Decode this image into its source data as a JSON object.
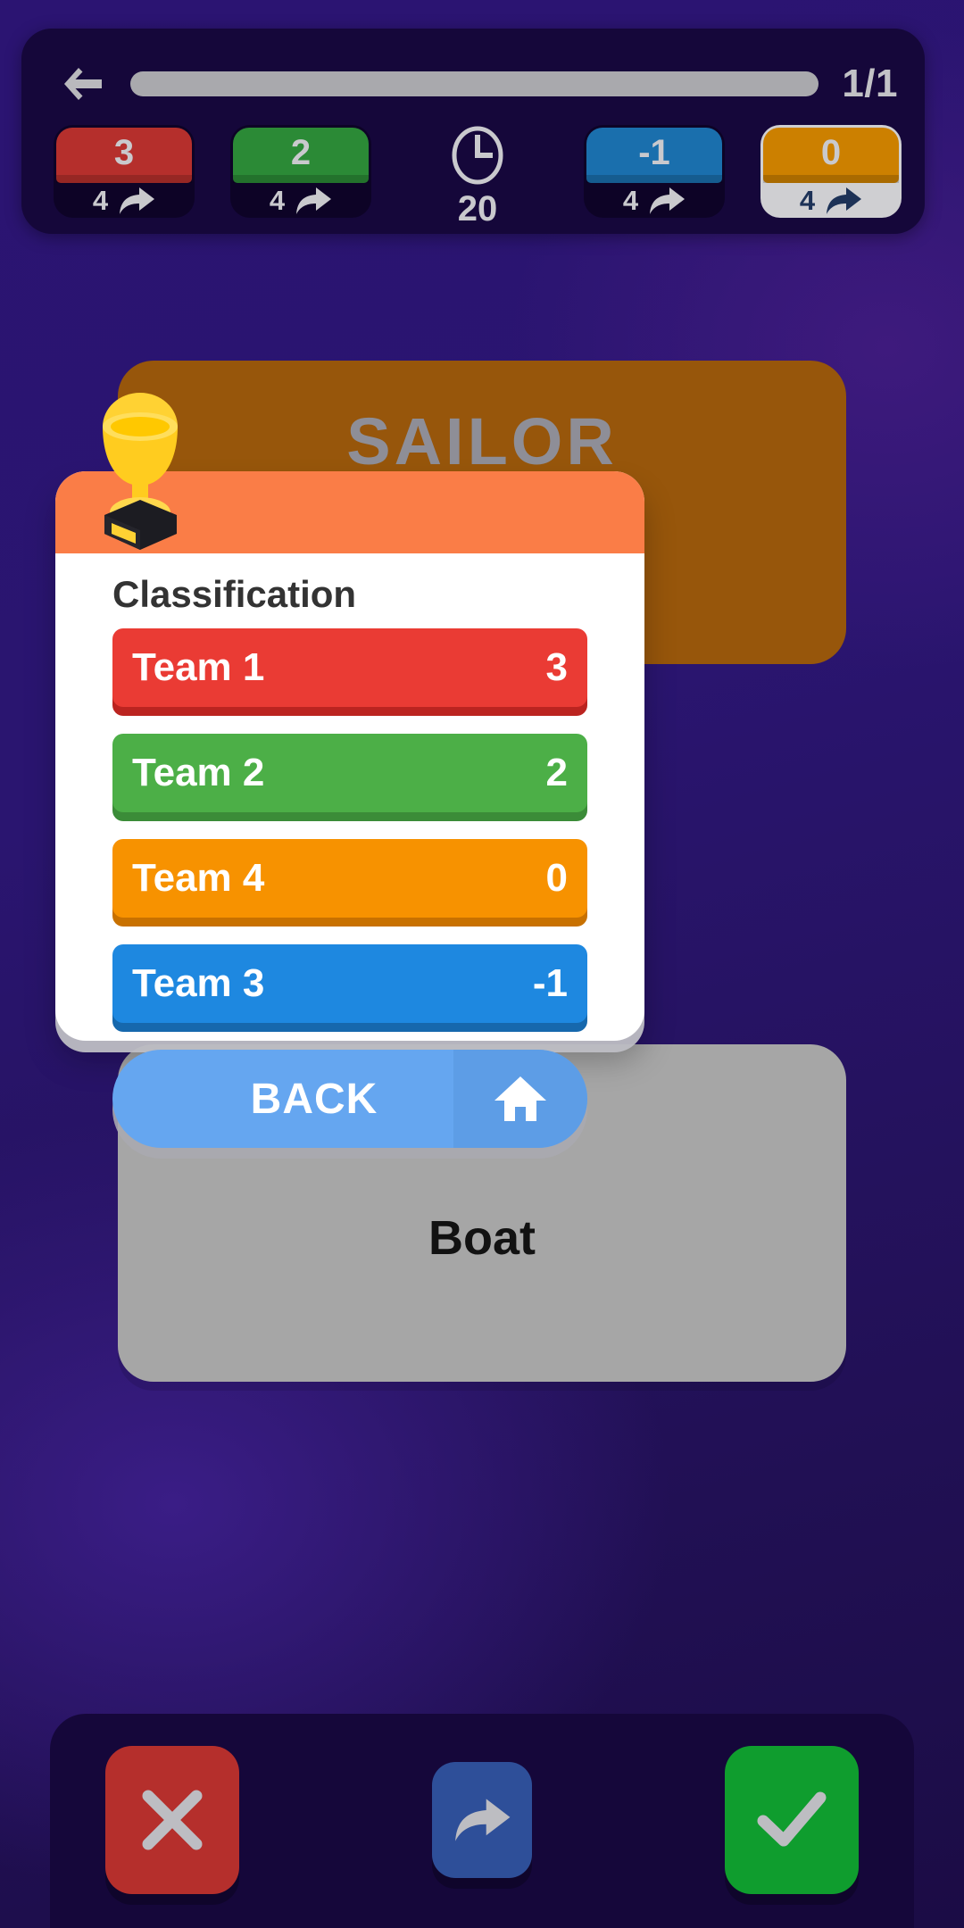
{
  "hud": {
    "back_icon": "back-arrow-icon",
    "progress_label": "",
    "page_count": "1/1",
    "clock": {
      "icon": "clock-icon",
      "seconds": "20"
    },
    "cards": [
      {
        "score": "3",
        "count": "4",
        "color": "#b52f2c",
        "shade": "#8f2421",
        "icon": "share-arrow-icon",
        "active": "false"
      },
      {
        "score": "2",
        "count": "4",
        "color": "#2b8a36",
        "shade": "#206a29",
        "icon": "share-arrow-icon",
        "active": "false"
      },
      {
        "score": "-1",
        "count": "4",
        "color": "#1a6fad",
        "shade": "#145786",
        "icon": "share-arrow-icon",
        "active": "false"
      },
      {
        "score": "0",
        "count": "4",
        "color": "#cc8000",
        "shade": "#a66700",
        "icon": "share-arrow-icon",
        "active": "true"
      }
    ]
  },
  "background_card": {
    "word": "SAILOR"
  },
  "gray_card": {
    "label": "Boat"
  },
  "modal": {
    "trophy_icon": "trophy-icon",
    "title": "Classification",
    "rows": [
      {
        "name": "Team 1",
        "score": "3",
        "color": "#ea3b34",
        "shade": "#bb2420"
      },
      {
        "name": "Team 2",
        "score": "2",
        "color": "#4caf47",
        "shade": "#3b8c38"
      },
      {
        "name": "Team 4",
        "score": "0",
        "color": "#f79200",
        "shade": "#c87100"
      },
      {
        "name": "Team 3",
        "score": "-1",
        "color": "#1e88e0",
        "shade": "#1668ad"
      }
    ],
    "back_button": {
      "label": "BACK",
      "icon": "home-icon"
    }
  },
  "action_bar": {
    "cancel": {
      "icon": "close-x-icon",
      "color": "#b52f2c"
    },
    "share": {
      "icon": "share-arrow-icon",
      "color": "#2e4f99"
    },
    "confirm": {
      "icon": "check-icon",
      "color": "#0f9d2e"
    }
  }
}
